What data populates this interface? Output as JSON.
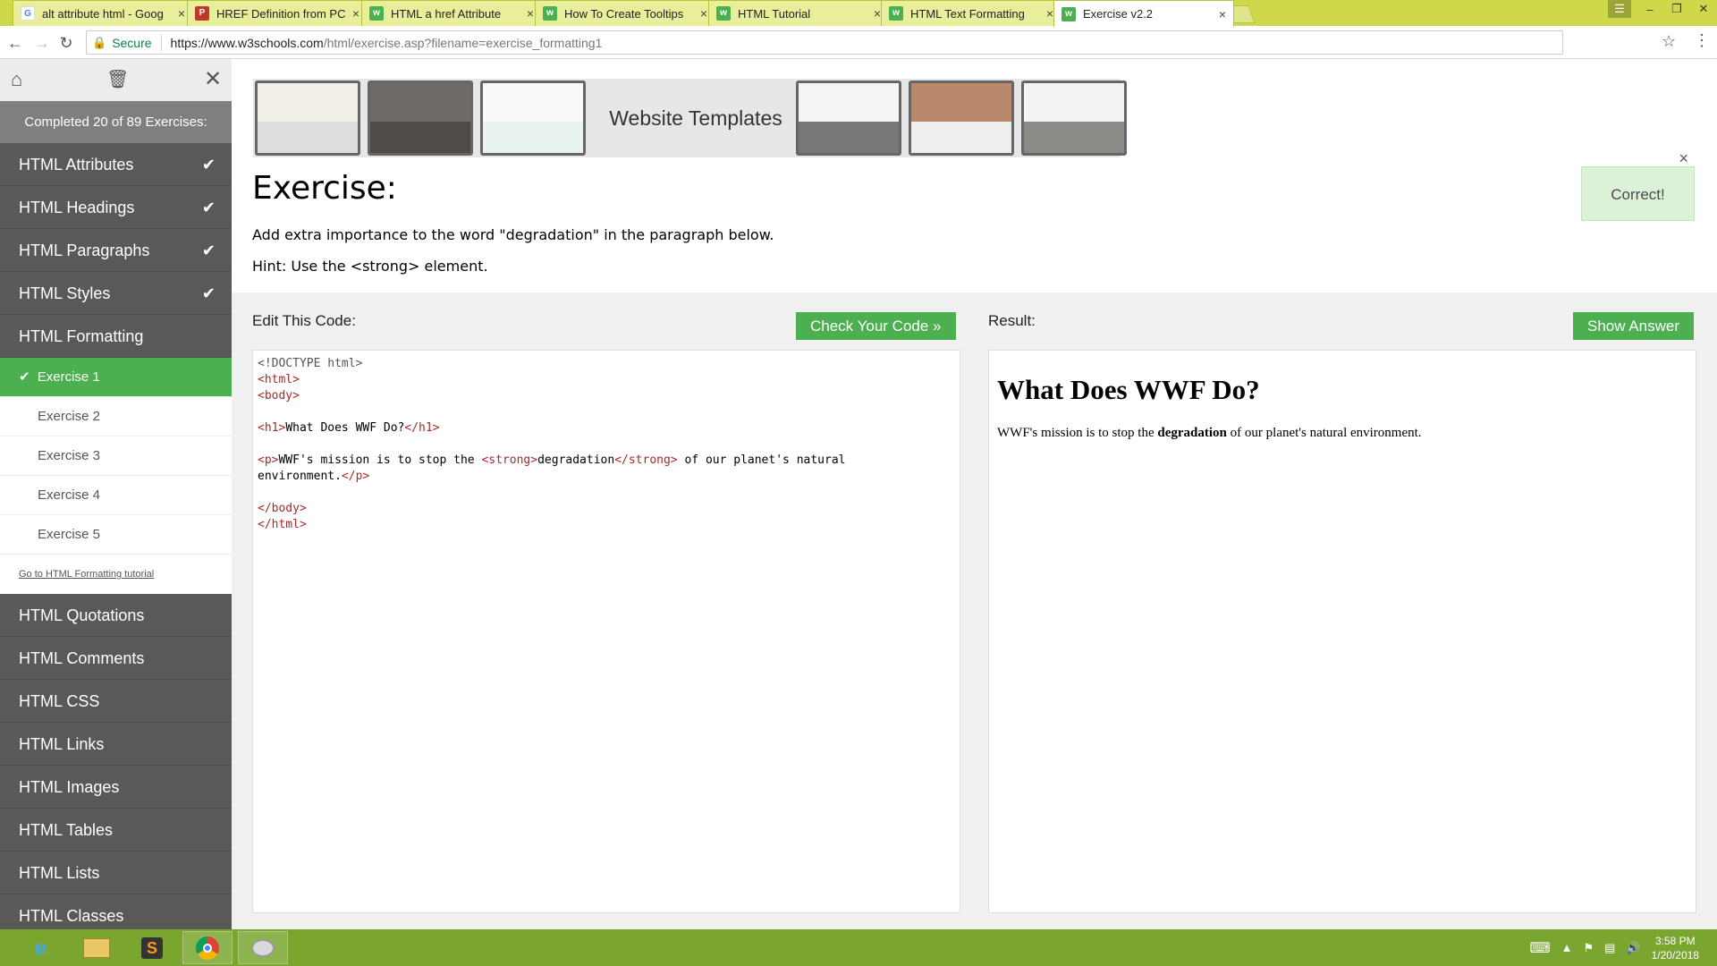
{
  "browser": {
    "tabs": [
      {
        "title": "alt attribute html - Goog",
        "favicon": "google-icon",
        "color": "#ffffff"
      },
      {
        "title": "HREF Definition from PC",
        "favicon": "pc-icon",
        "color": "#c0392b"
      },
      {
        "title": "HTML a href Attribute",
        "favicon": "w3schools-icon",
        "color": "#4caf50"
      },
      {
        "title": "How To Create Tooltips",
        "favicon": "w3schools-icon",
        "color": "#4caf50"
      },
      {
        "title": "HTML Tutorial",
        "favicon": "w3schools-icon",
        "color": "#4caf50"
      },
      {
        "title": "HTML Text Formatting",
        "favicon": "w3schools-icon",
        "color": "#4caf50"
      },
      {
        "title": "Exercise v2.2",
        "favicon": "w3schools-icon",
        "color": "#4caf50"
      }
    ],
    "secure_label": "Secure",
    "url_host": "https://www.w3schools.com",
    "url_path": "/html/exercise.asp?filename=exercise_formatting1"
  },
  "sidebar": {
    "progress": "Completed 20 of 89 Exercises:",
    "topics_before": [
      {
        "label": "HTML Attributes",
        "done": true
      },
      {
        "label": "HTML Headings",
        "done": true
      },
      {
        "label": "HTML Paragraphs",
        "done": true
      },
      {
        "label": "HTML Styles",
        "done": true
      }
    ],
    "open_topic": "HTML Formatting",
    "exercises": [
      "Exercise 1",
      "Exercise 2",
      "Exercise 3",
      "Exercise 4",
      "Exercise 5"
    ],
    "tutorial_link": "Go to HTML Formatting tutorial",
    "topics_after": [
      "HTML Quotations",
      "HTML Comments",
      "HTML CSS",
      "HTML Links",
      "HTML Images",
      "HTML Tables",
      "HTML Lists",
      "HTML Classes"
    ]
  },
  "ads": {
    "label": "Website Templates"
  },
  "exercise": {
    "title": "Exercise:",
    "instruction": "Add extra importance to the word \"degradation\" in the paragraph below.",
    "hint": "Hint: Use the <strong> element.",
    "status": "Correct!"
  },
  "editor": {
    "label": "Edit This Code:",
    "check_button": "Check Your Code »",
    "lines": [
      {
        "parts": [
          {
            "t": "<!DOCTYPE html>",
            "c": "doc"
          }
        ]
      },
      {
        "parts": [
          {
            "t": "<html>",
            "c": "tag"
          }
        ]
      },
      {
        "parts": [
          {
            "t": "<body>",
            "c": "tag"
          }
        ]
      },
      {
        "parts": []
      },
      {
        "parts": [
          {
            "t": "<h1>",
            "c": "tag"
          },
          {
            "t": "What Does WWF Do?",
            "c": ""
          },
          {
            "t": "</h1>",
            "c": "tag"
          }
        ]
      },
      {
        "parts": []
      },
      {
        "parts": [
          {
            "t": "<p>",
            "c": "tag"
          },
          {
            "t": "WWF's mission is to stop the ",
            "c": ""
          },
          {
            "t": "<strong>",
            "c": "tag"
          },
          {
            "t": "degradation",
            "c": ""
          },
          {
            "t": "</strong>",
            "c": "tag"
          },
          {
            "t": " of our planet's natural",
            "c": ""
          }
        ]
      },
      {
        "parts": [
          {
            "t": "environment.",
            "c": ""
          },
          {
            "t": "</p>",
            "c": "tag"
          }
        ]
      },
      {
        "parts": []
      },
      {
        "parts": [
          {
            "t": "</body>",
            "c": "tag"
          }
        ]
      },
      {
        "parts": [
          {
            "t": "</html>",
            "c": "tag"
          }
        ]
      }
    ]
  },
  "result": {
    "label": "Result:",
    "answer_button": "Show Answer",
    "heading": "What Does WWF Do?",
    "para_before": "WWF's mission is to stop the ",
    "para_strong": "degradation",
    "para_after": " of our planet's natural environment."
  },
  "taskbar": {
    "time": "3:58 PM",
    "date": "1/20/2018"
  }
}
